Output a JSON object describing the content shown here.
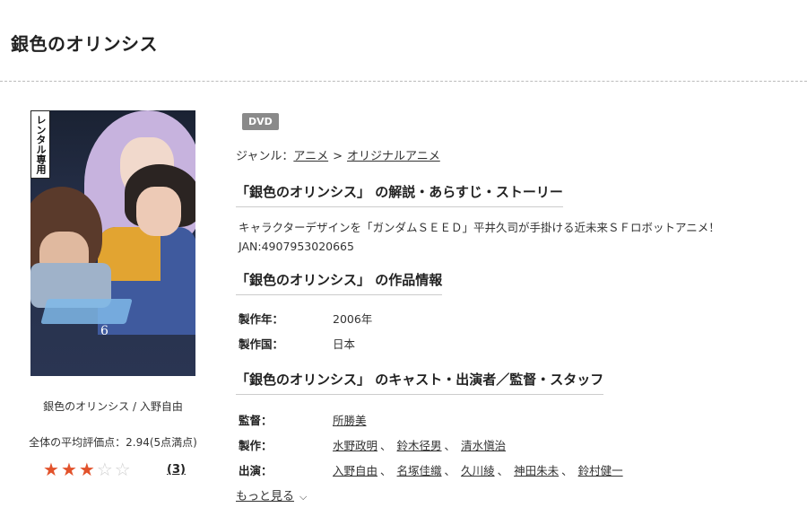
{
  "page": {
    "title": "銀色のオリンシス"
  },
  "cover": {
    "badge_text": "レンタル専用",
    "dvd_mark": "DVD",
    "volume": "6"
  },
  "left": {
    "meta_title": "銀色のオリンシス / 入野自由",
    "avg_rating_label": "全体の平均評価点：2.94(5点満点)",
    "rating_value": 3,
    "rating_max": 5,
    "rating_count": "(3)"
  },
  "detail": {
    "format": "DVD",
    "genre_label": "ジャンル：",
    "genre_sep": ">",
    "genres": [
      "アニメ",
      "オリジナルアニメ"
    ],
    "section_synopsis": "「銀色のオリンシス」 の解説・あらすじ・ストーリー",
    "synopsis": "キャラクターデザインを「ガンダムＳＥＥＤ」平井久司が手掛ける近未来ＳＦロボットアニメ！",
    "jan": "JAN:4907953020665",
    "section_info": "「銀色のオリンシス」 の作品情報",
    "year_label": "製作年：",
    "year": "2006年",
    "country_label": "製作国：",
    "country": "日本",
    "section_cast": "「銀色のオリンシス」 のキャスト・出演者／監督・スタッフ",
    "director_label": "監督：",
    "directors": [
      "所勝美"
    ],
    "producer_label": "製作：",
    "producers": [
      "水野政明",
      "鈴木径男",
      "清水愼治"
    ],
    "cast_label": "出演：",
    "cast": [
      "入野自由",
      "名塚佳織",
      "久川綾",
      "神田朱未",
      "鈴村健一"
    ],
    "list_separator": "、",
    "more_label": "もっと見る"
  },
  "colors": {
    "star_full": "#e2522b",
    "star_empty": "#cfcfcf",
    "badge_bg": "#8a8a8a"
  }
}
